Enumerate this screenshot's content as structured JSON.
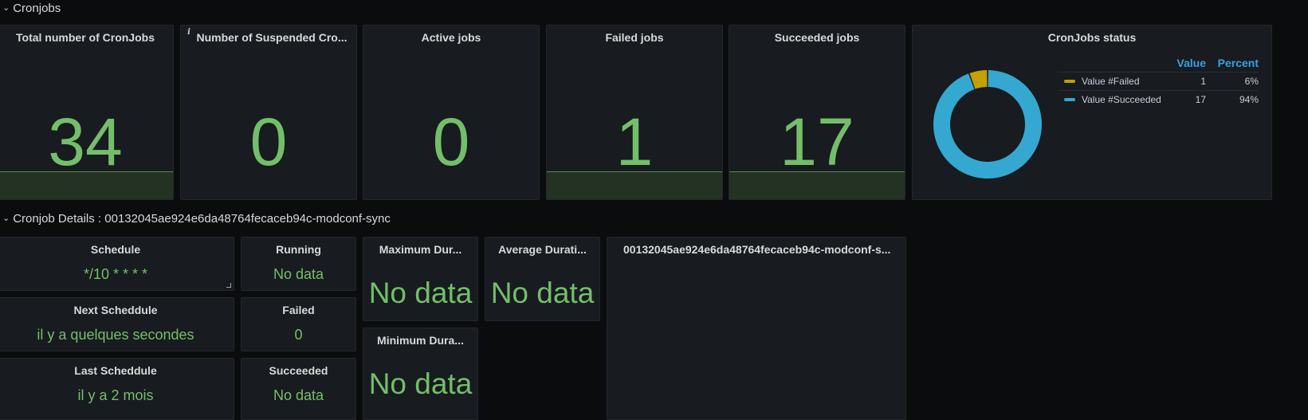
{
  "rows": {
    "cronjobs": {
      "title": "Cronjobs"
    },
    "details": {
      "title": "Cronjob Details : 00132045ae924e6da48764fecaceb94c-modconf-sync"
    }
  },
  "stats": {
    "total": {
      "title": "Total number of CronJobs",
      "value": "34"
    },
    "suspended": {
      "title": "Number of Suspended Cro...",
      "value": "0",
      "info_icon": "i"
    },
    "active": {
      "title": "Active jobs",
      "value": "0"
    },
    "failed": {
      "title": "Failed jobs",
      "value": "1"
    },
    "succeeded": {
      "title": "Succeeded jobs",
      "value": "17"
    }
  },
  "cronjobs_status": {
    "title": "CronJobs status",
    "headers": {
      "value": "Value",
      "percent": "Percent"
    },
    "legend": [
      {
        "name": "Value #Failed",
        "value": "1",
        "percent": "6%",
        "color": "#c4a000"
      },
      {
        "name": "Value #Succeeded",
        "value": "17",
        "percent": "94%",
        "color": "#34a8d1"
      }
    ]
  },
  "chart_data": {
    "type": "pie",
    "title": "CronJobs status",
    "categories": [
      "Value #Failed",
      "Value #Succeeded"
    ],
    "values": [
      1,
      17
    ],
    "percent": [
      6,
      94
    ],
    "colors": [
      "#c4a000",
      "#34a8d1"
    ],
    "donut": true,
    "legend_placement": "right"
  },
  "details": {
    "schedule": {
      "title": "Schedule",
      "value": "*/10 * * * *"
    },
    "running": {
      "title": "Running",
      "value": "No data"
    },
    "max_duration": {
      "title": "Maximum Dur...",
      "value": "No data"
    },
    "avg_duration": {
      "title": "Average Durati...",
      "value": "No data"
    },
    "job_panel": {
      "title": "00132045ae924e6da48764fecaceb94c-modconf-s..."
    },
    "next_schedule": {
      "title": "Next Scheddule",
      "value": "il y a quelques secondes"
    },
    "failed": {
      "title": "Failed",
      "value": "0"
    },
    "min_duration": {
      "title": "Minimum Dura...",
      "value": "No data"
    },
    "last_schedule": {
      "title": "Last Scheddule",
      "value": "il y a 2 mois"
    },
    "succeeded": {
      "title": "Succeeded",
      "value": "No data"
    }
  },
  "colors": {
    "background": "#0b0c0e",
    "panel": "#181b1f",
    "green": "#73bf69",
    "blue_header": "#33a2e5"
  }
}
